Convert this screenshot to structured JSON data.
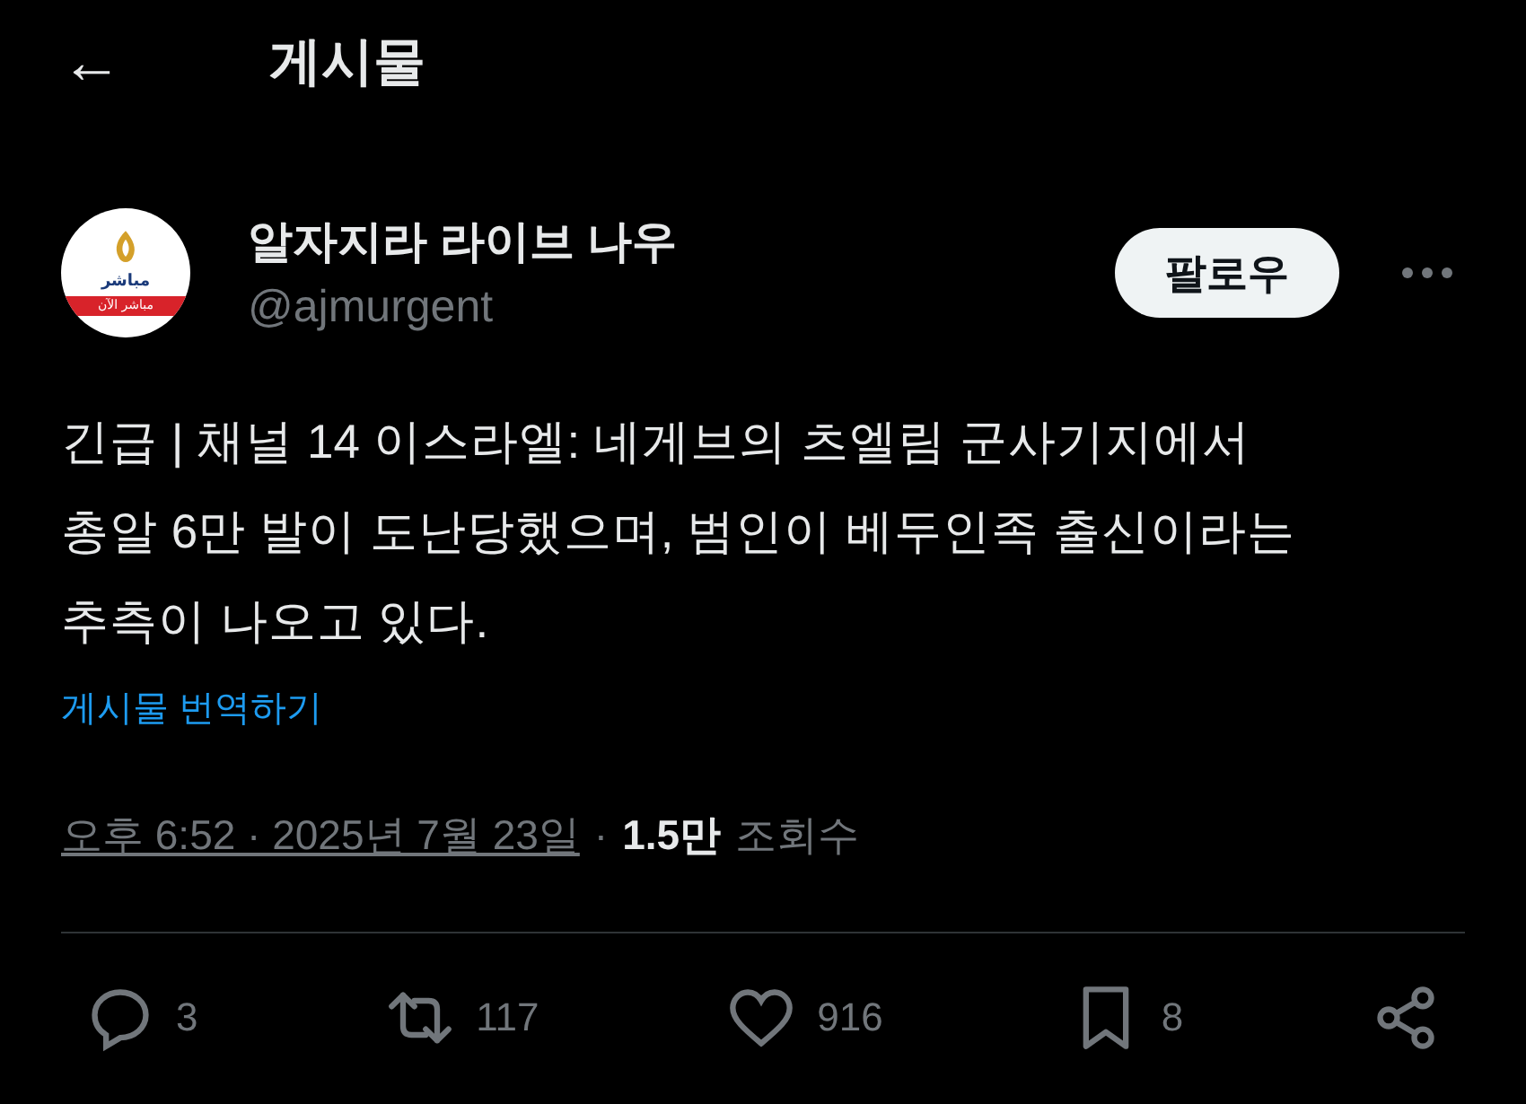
{
  "header": {
    "back_icon": "←",
    "title": "게시물"
  },
  "author": {
    "name": "알자지라 라이브 나우",
    "handle": "@ajmurgent",
    "avatar_text": "مباشر",
    "avatar_band": "مباشر الآن",
    "follow": "팔로우"
  },
  "post": {
    "lines": [
      "긴급 | 채널 14 이스라엘: 네게브의 츠엘림 군사기지에서",
      "총알 6만 발이 도난당했으며, 범인이 베두인족 출신이라는",
      "추측이 나오고 있다."
    ],
    "translate": "게시물 번역하기",
    "time": "오후 6:52 · 2025년 7월 23일",
    "separator": "·",
    "views": "1.5만",
    "views_label": "조회수"
  },
  "actions": [
    {
      "kind": "reply",
      "count": "3"
    },
    {
      "kind": "repost",
      "count": "117"
    },
    {
      "kind": "like",
      "count": "916"
    },
    {
      "kind": "bookmark",
      "count": "8"
    },
    {
      "kind": "share"
    }
  ]
}
